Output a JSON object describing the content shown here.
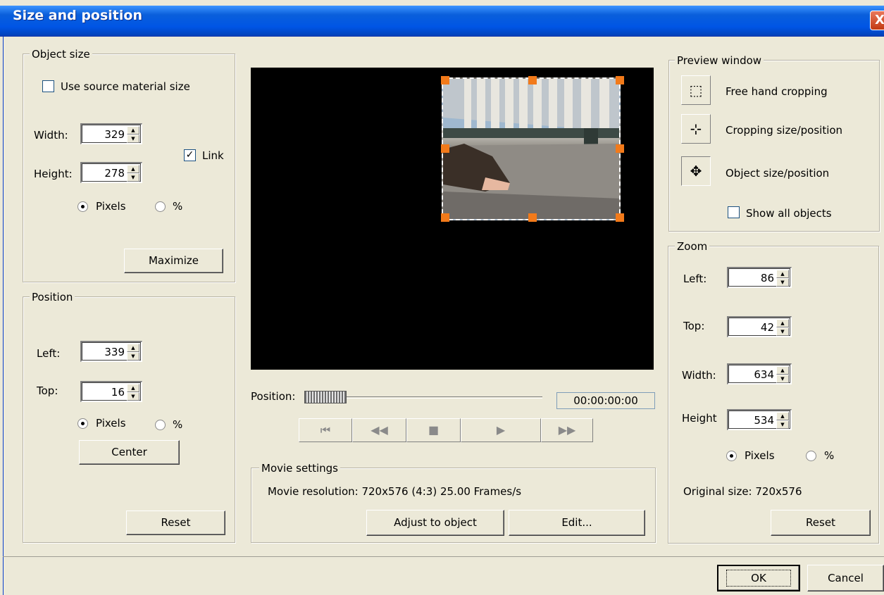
{
  "window": {
    "title": "Size and position",
    "close_glyph": "X"
  },
  "object_size": {
    "legend": "Object size",
    "use_source_label": "Use source material size",
    "use_source_checked": false,
    "width_label": "Width:",
    "width_value": "329",
    "height_label": "Height:",
    "height_value": "278",
    "link_label": "Link",
    "link_checked": true,
    "unit_pixels": "Pixels",
    "unit_percent": "%",
    "selected_unit": "Pixels",
    "maximize_label": "Maximize"
  },
  "position": {
    "legend": "Position",
    "left_label": "Left:",
    "left_value": "339",
    "top_label": "Top:",
    "top_value": "16",
    "unit_pixels": "Pixels",
    "unit_percent": "%",
    "selected_unit": "Pixels",
    "center_label": "Center",
    "reset_label": "Reset"
  },
  "playback": {
    "position_label": "Position:",
    "timecode": "00:00:00:00",
    "buttons": [
      "go-to-start",
      "rewind",
      "stop",
      "play",
      "fast-forward"
    ]
  },
  "movie_settings": {
    "legend": "Movie settings",
    "resolution_text": "Movie resolution: 720x576 (4:3) 25.00 Frames/s",
    "adjust_label": "Adjust to object",
    "edit_label": "Edit..."
  },
  "preview_window": {
    "legend": "Preview window",
    "modes": [
      {
        "label": "Free hand cropping",
        "icon": "crop-freehand-icon"
      },
      {
        "label": "Cropping size/position",
        "icon": "crop-move-icon"
      },
      {
        "label": "Object size/position",
        "icon": "object-move-icon"
      }
    ],
    "selected_mode": "Object size/position",
    "show_all_label": "Show all objects",
    "show_all_checked": false
  },
  "zoom": {
    "legend": "Zoom",
    "left_label": "Left:",
    "left_value": "86",
    "top_label": "Top:",
    "top_value": "42",
    "width_label": "Width:",
    "width_value": "634",
    "height_label": "Height",
    "height_value": "534",
    "unit_pixels": "Pixels",
    "unit_percent": "%",
    "selected_unit": "Pixels",
    "original_size": "Original size: 720x576",
    "reset_label": "Reset"
  },
  "footer": {
    "ok_label": "OK",
    "cancel_label": "Cancel"
  }
}
